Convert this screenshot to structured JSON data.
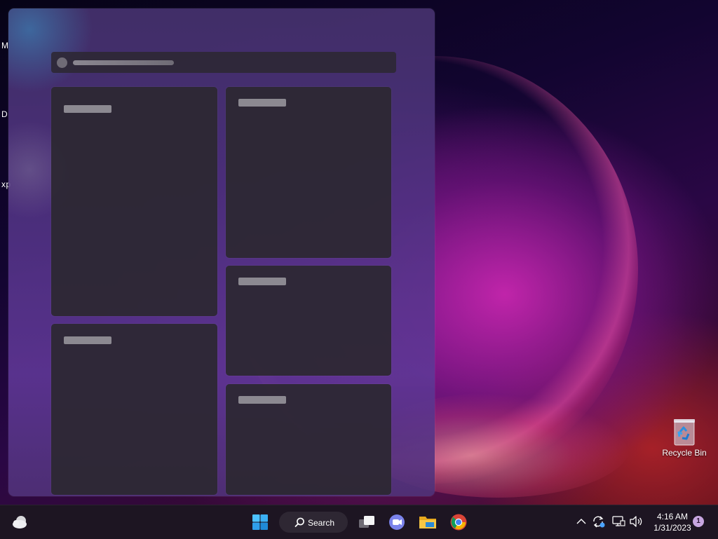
{
  "desktop": {
    "edge_letters": [
      "M",
      "D",
      "xp"
    ],
    "recycle_bin_label": "Recycle Bin"
  },
  "widgets_panel": {
    "state": "loading-placeholders",
    "cards": 5
  },
  "taskbar": {
    "search_label": "Search",
    "pinned_apps": [
      "start",
      "search",
      "task-view",
      "teams-chat",
      "file-explorer",
      "chrome"
    ],
    "clock": {
      "time": "4:16 AM",
      "date": "1/31/2023"
    },
    "notification_count": "1",
    "colors": {
      "start_blue": "#4cc2ff",
      "folder_yellow": "#f6c744",
      "teams_purple": "#7b83eb",
      "chrome_red": "#db4437",
      "chrome_green": "#0f9d58",
      "chrome_yellow": "#f4b400",
      "chrome_blue": "#4285f4"
    }
  }
}
